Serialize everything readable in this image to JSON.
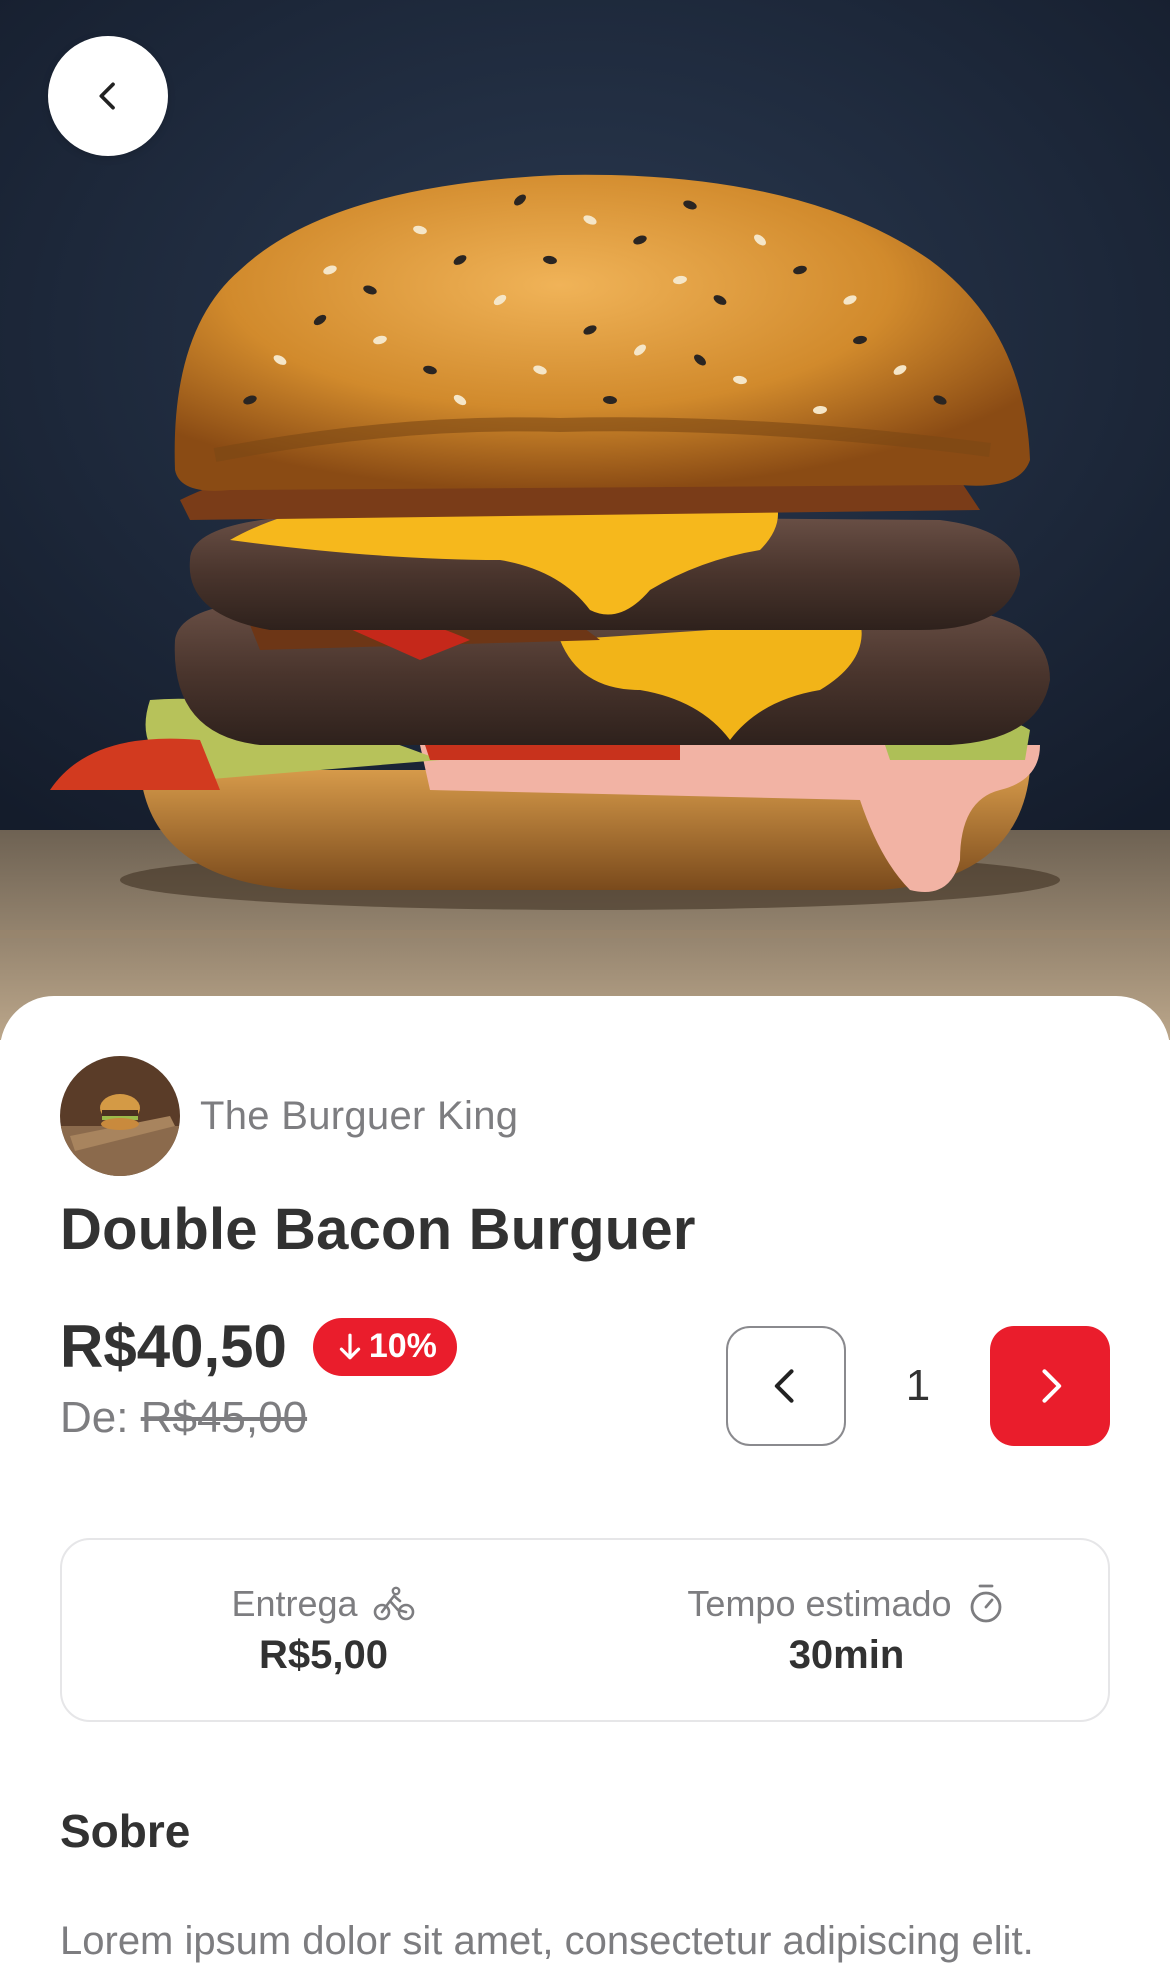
{
  "header": {
    "back_button": {
      "icon": "chevron-left-icon"
    }
  },
  "product": {
    "image_alt": "Double Bacon Burguer",
    "restaurant_name": "The Burguer King",
    "name": "Double Bacon Burguer",
    "price": "R$40,50",
    "discount": "10%",
    "old_price_prefix": "De:",
    "old_price": "R$45,00"
  },
  "quantity": {
    "value": "1",
    "decrement_icon": "chevron-left-icon",
    "increment_icon": "chevron-right-icon"
  },
  "delivery": {
    "fee_label": "Entrega",
    "fee_value": "R$5,00",
    "fee_icon": "bike-icon",
    "time_label": "Tempo estimado",
    "time_value": "30min",
    "time_icon": "timer-icon"
  },
  "about": {
    "title": "Sobre",
    "text": "Lorem ipsum dolor sit amet, consectetur adipiscing elit. Aenean nec nisl lorem. Praesent pharetra"
  },
  "colors": {
    "accent": "#ea1d2c",
    "text_primary": "#323232",
    "text_secondary": "#7d7d80",
    "border": "#e6e6e8"
  }
}
